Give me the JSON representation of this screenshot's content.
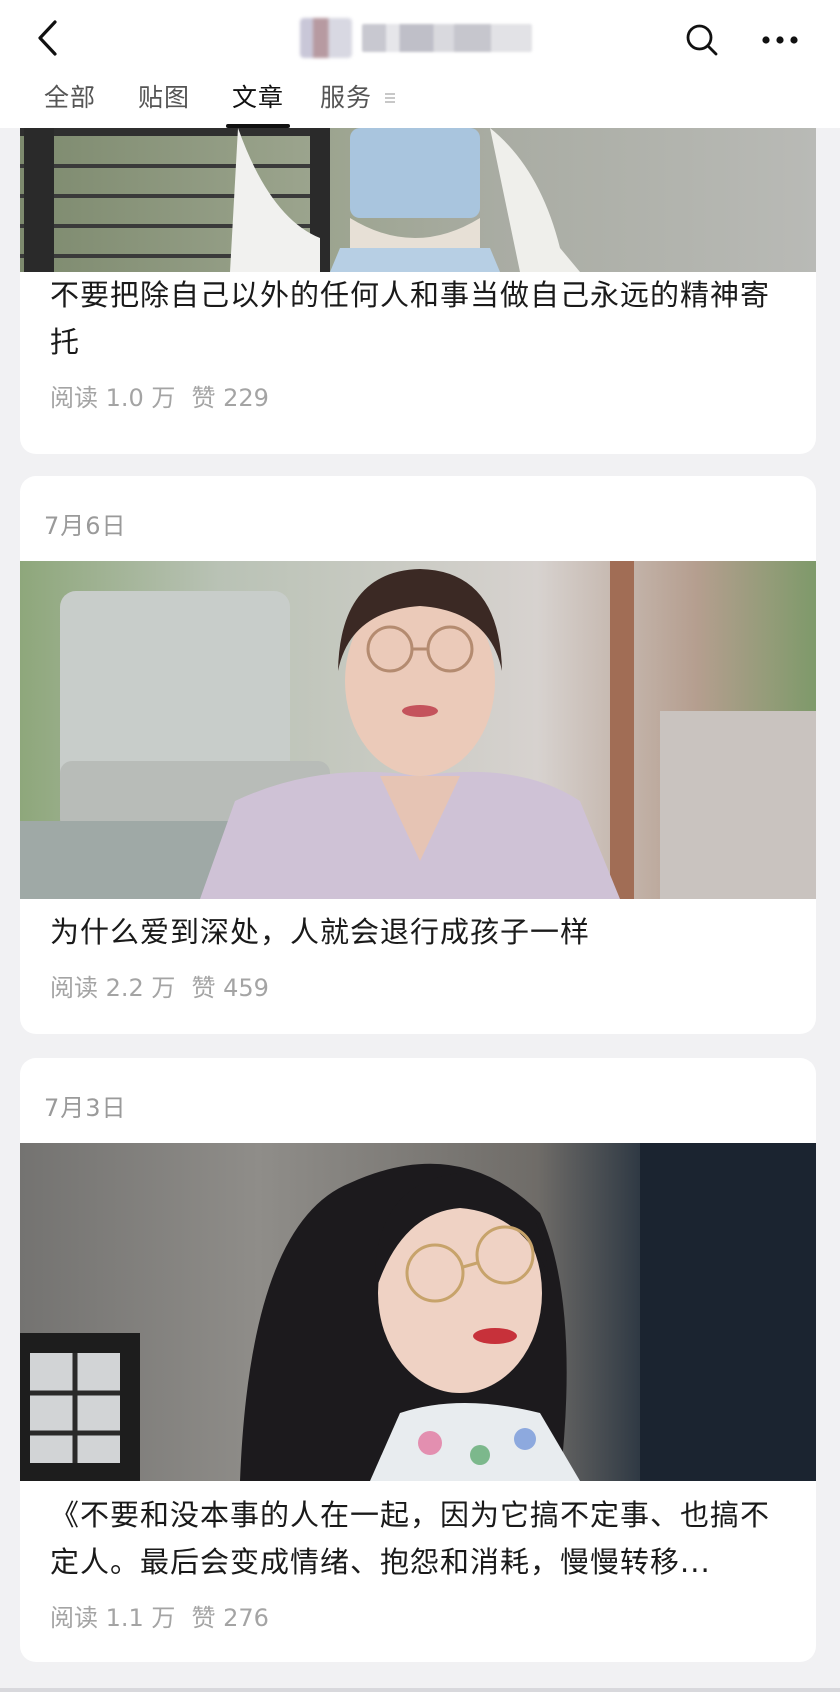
{
  "header": {
    "tabs": [
      {
        "label": "全部",
        "active": false
      },
      {
        "label": "贴图",
        "active": false
      },
      {
        "label": "文章",
        "active": true
      },
      {
        "label": "服务",
        "active": false
      }
    ],
    "icons": {
      "back": "back-arrow-icon",
      "search": "search-icon",
      "more": "more-dots-icon",
      "tab_menu": "menu-lines-icon"
    }
  },
  "articles": [
    {
      "date": "",
      "title": "不要把除自己以外的任何人和事当做自己永远的精神寄托",
      "reads": "阅读 1.0 万",
      "likes": "赞 229"
    },
    {
      "date": "7月6日",
      "title": "为什么爱到深处，人就会退行成孩子一样",
      "reads": "阅读 2.2 万",
      "likes": "赞 459"
    },
    {
      "date": "7月3日",
      "title": "《不要和没本事的人在一起，因为它搞不定事、也搞不定人。最后会变成情绪、抱怨和消耗，慢慢转移...",
      "reads": "阅读 1.1 万",
      "likes": "赞 276"
    }
  ],
  "colors": {
    "feed_bg": "#f1f1f3",
    "card_bg": "#ffffff",
    "meta_text": "#a4a4a4",
    "active_tab": "#111111"
  }
}
